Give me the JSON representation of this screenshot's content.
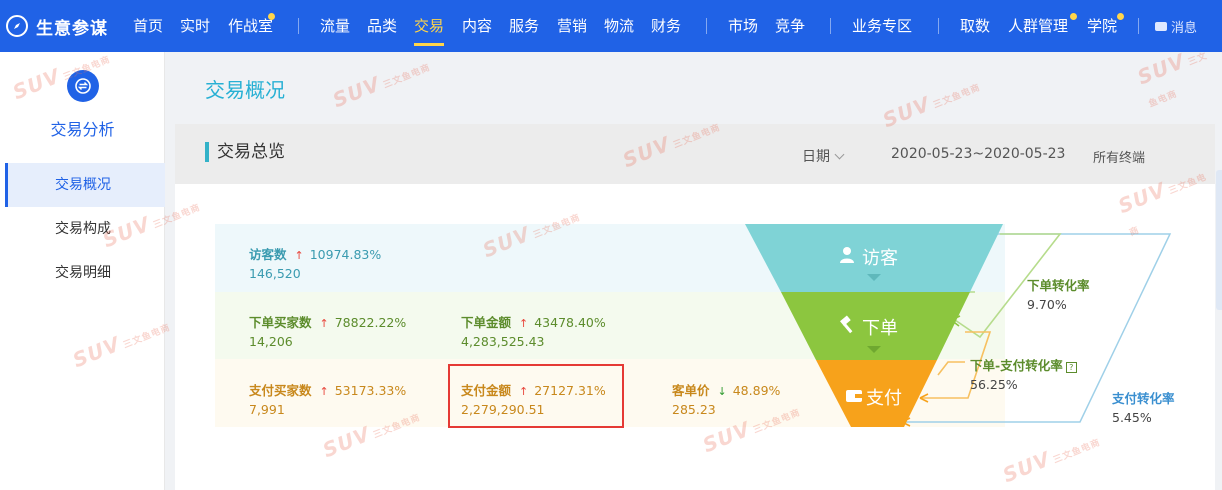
{
  "brand": {
    "name": "生意参谋",
    "logo_icon": "compass-icon"
  },
  "nav": {
    "items": [
      {
        "key": "home",
        "label": "首页",
        "left": 0
      },
      {
        "key": "realtime",
        "label": "实时"
      },
      {
        "key": "warroom",
        "label": "作战室",
        "dot": true
      },
      {
        "key": "traffic",
        "label": "流量"
      },
      {
        "key": "category",
        "label": "品类"
      },
      {
        "key": "trade",
        "label": "交易",
        "active": true
      },
      {
        "key": "content",
        "label": "内容"
      },
      {
        "key": "service",
        "label": "服务"
      },
      {
        "key": "marketing",
        "label": "营销"
      },
      {
        "key": "logistics",
        "label": "物流"
      },
      {
        "key": "finance",
        "label": "财务"
      },
      {
        "key": "market",
        "label": "市场"
      },
      {
        "key": "compete",
        "label": "竞争"
      },
      {
        "key": "business_zone",
        "label": "业务专区"
      },
      {
        "key": "fetch",
        "label": "取数"
      },
      {
        "key": "crowd",
        "label": "人群管理",
        "dot": true
      },
      {
        "key": "academy",
        "label": "学院",
        "dot": true
      }
    ],
    "message_label": "消息",
    "active_color": "#ffd54a",
    "bar_color": "#2062e6"
  },
  "sidebar": {
    "title": "交易分析",
    "icon": "exchange-icon",
    "items": [
      {
        "label": "交易概况",
        "active": true
      },
      {
        "label": "交易构成"
      },
      {
        "label": "交易明细"
      }
    ]
  },
  "page": {
    "title": "交易概况",
    "section_title": "交易总览",
    "date_label": "日期",
    "date_range": "2020-05-23~2020-05-23",
    "terminal": "所有终端"
  },
  "metrics": {
    "visitors": {
      "label": "访客数",
      "change": "10974.83%",
      "value": "146,520",
      "direction": "up"
    },
    "order_buyers": {
      "label": "下单买家数",
      "change": "78822.22%",
      "value": "14,206",
      "direction": "up"
    },
    "order_amount": {
      "label": "下单金额",
      "change": "43478.40%",
      "value": "4,283,525.43",
      "direction": "up"
    },
    "pay_buyers": {
      "label": "支付买家数",
      "change": "53173.33%",
      "value": "7,991",
      "direction": "up"
    },
    "pay_amount": {
      "label": "支付金额",
      "change": "27127.31%",
      "value": "2,279,290.51",
      "direction": "up"
    },
    "avg_price": {
      "label": "客单价",
      "change": "48.89%",
      "value": "285.23",
      "direction": "down"
    }
  },
  "funnel": {
    "stages": [
      {
        "label": "访客",
        "icon": "user-icon",
        "color": "#7fd3d6"
      },
      {
        "label": "下单",
        "icon": "hammer-icon",
        "color": "#8cc63f"
      },
      {
        "label": "支付",
        "icon": "wallet-icon",
        "color": "#f7a21b"
      }
    ],
    "conversions": {
      "order_rate": {
        "label": "下单转化率",
        "value": "9.70%"
      },
      "order_pay_rate": {
        "label": "下单-支付转化率",
        "value": "56.25%"
      },
      "pay_rate": {
        "label": "支付转化率",
        "value": "5.45%"
      }
    }
  },
  "watermark": {
    "text": "SUV",
    "sub": "三文鱼电商"
  }
}
